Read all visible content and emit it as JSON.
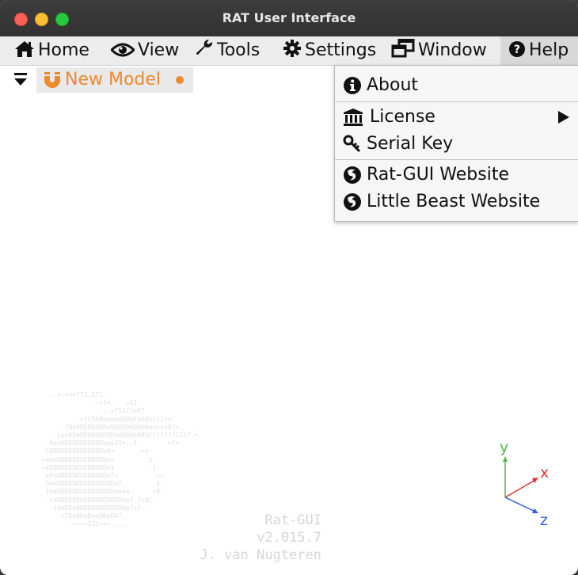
{
  "window": {
    "title": "RAT User Interface"
  },
  "menubar": {
    "items": [
      {
        "label": "Home",
        "icon": "home-icon"
      },
      {
        "label": "View",
        "icon": "eye-icon"
      },
      {
        "label": "Tools",
        "icon": "wrench-icon"
      },
      {
        "label": "Settings",
        "icon": "gear-icon"
      },
      {
        "label": "Window",
        "icon": "window-restore-icon"
      },
      {
        "label": "Help",
        "icon": "question-circle-icon",
        "active": true
      }
    ]
  },
  "tabs": [
    {
      "label": "New Model",
      "icon": "magnet-icon",
      "modified": true
    }
  ],
  "help_menu": {
    "items": [
      {
        "label": "About",
        "icon": "info-circle-icon"
      },
      {
        "label": "License",
        "icon": "bank-icon",
        "has_submenu": true
      },
      {
        "label": "Serial Key",
        "icon": "key-icon"
      },
      {
        "label": "Rat-GUI Website",
        "icon": "firefox-icon"
      },
      {
        "label": "Little Beast Website",
        "icon": "firefox-icon"
      }
    ]
  },
  "watermark": {
    "app_name": "Rat-GUI",
    "version": "v2.015.7",
    "author": "J. van Nugteren",
    "ascii_art": "   ..>.>>>??1.171.\n              ..>1>.   >11.\n                ...>71111e87\n          .>7C568eeeeDDDeE$D8SC71>>.\n      .79eDDDDDDDDeDDDDDeDDDDe<>>e87>.   .\n    .CeeDDeDDDDDDDDDeeDDDe895CC77777CC27.>.\n  .AeeDDDDDDDDDDDeee31>..1.       >7>\n  CDDDDDDDDDDDDDDeA>      .>>\n >eeeDDDDDDDDDDDDDe>        .1.\n >eDDDDDDDDDDDDDDDe1         .1.\n .eDeDDDDDDDDDDDDDe2>         .>>\n  5eeDDDDDDDDDDDDDDDe7.        1.\n  1eeDDDDDDDDDDDDDDDeee4.     >9.\n  .CeDDDDDDDDDDDDDDDDDDe7.7>8C.\n   .14eDDeDDDDDDDDDDDDDe7>7..\n     .>75eDDeDeeDDeD67.\n        .>>>>111>>>.....",
    "axis_labels": [
      "y",
      "x",
      "z"
    ]
  },
  "colors": {
    "accent": "#ec8a2e",
    "axis_x": "#e0322f",
    "axis_y": "#4cb84c",
    "axis_z": "#2f5ee0"
  }
}
